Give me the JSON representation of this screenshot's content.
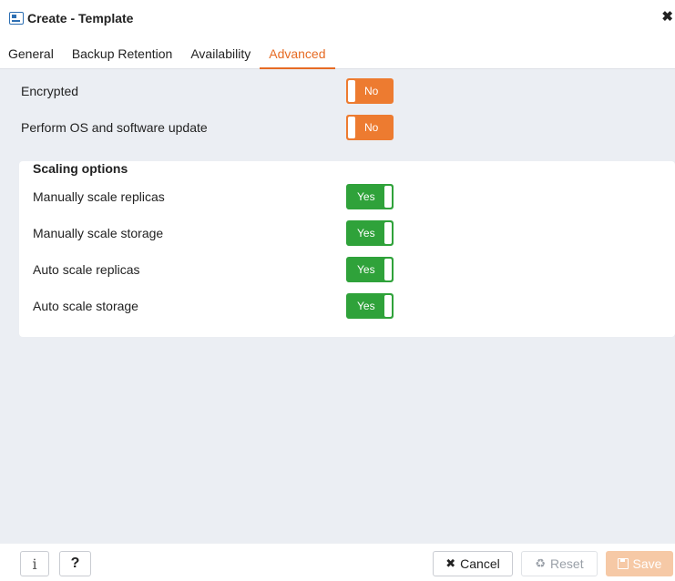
{
  "dialog": {
    "title": "Create - Template",
    "close_glyph": "✖"
  },
  "tabs": [
    {
      "label": "General",
      "active": false
    },
    {
      "label": "Backup Retention",
      "active": false
    },
    {
      "label": "Availability",
      "active": false
    },
    {
      "label": "Advanced",
      "active": true
    }
  ],
  "fields": {
    "encrypted": {
      "label": "Encrypted",
      "value": "No",
      "state": "off"
    },
    "os_update": {
      "label": "Perform OS and software update",
      "value": "No",
      "state": "off"
    }
  },
  "scaling": {
    "title": "Scaling options",
    "items": [
      {
        "label": "Manually scale replicas",
        "value": "Yes",
        "state": "on"
      },
      {
        "label": "Manually scale storage",
        "value": "Yes",
        "state": "on"
      },
      {
        "label": "Auto scale replicas",
        "value": "Yes",
        "state": "on"
      },
      {
        "label": "Auto scale storage",
        "value": "Yes",
        "state": "on"
      }
    ]
  },
  "footer": {
    "info_glyph": "i",
    "help_glyph": "?",
    "cancel_label": "Cancel",
    "reset_label": "Reset",
    "save_label": "Save"
  },
  "icons": {
    "window": "template-icon",
    "close": "close-icon",
    "cancel": "x-icon",
    "reset": "recycle-icon",
    "save": "floppy-disk-icon"
  },
  "colors": {
    "accent": "#e66b24",
    "toggle_off": "#ed7b30",
    "toggle_on": "#2fa23a",
    "content_bg": "#ebeef3"
  }
}
